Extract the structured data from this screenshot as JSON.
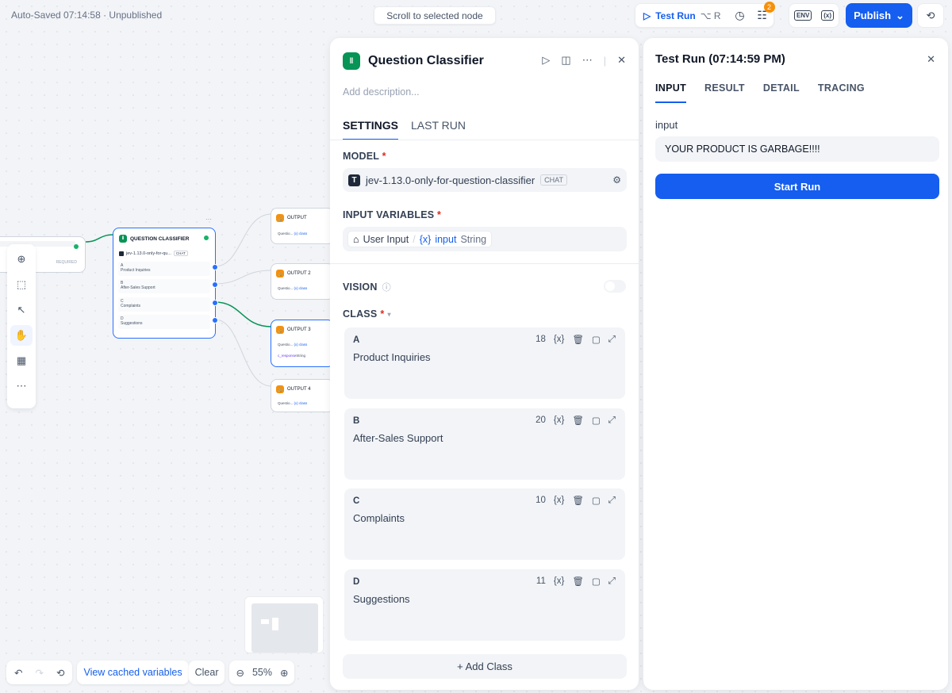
{
  "status": {
    "autosave": "Auto-Saved 07:14:58 · Unpublished"
  },
  "scroll_button": "Scroll to selected node",
  "topbar": {
    "test_run": "Test Run",
    "test_run_shortcut": "⌥ R",
    "checklist_badge": "2",
    "env_label": "ENV",
    "publish": "Publish"
  },
  "canvas_nodes": {
    "start_node_label": "REQUIRED",
    "classifier": {
      "title": "QUESTION CLASSIFIER",
      "model": "jev-1.13.0-only-for-qu...",
      "model_tag": "CHAT",
      "classes": [
        {
          "letter": "A",
          "name": "Product Inquiries"
        },
        {
          "letter": "B",
          "name": "After-Sales Support"
        },
        {
          "letter": "C",
          "name": "Complaints"
        },
        {
          "letter": "D",
          "name": "Suggestions"
        }
      ]
    },
    "outputs": [
      {
        "title": "OUTPUT",
        "var": "Questio...",
        "var2": "(x) class"
      },
      {
        "title": "OUTPUT 2",
        "var": "Questio...",
        "var2": "(x) class"
      },
      {
        "title": "OUTPUT 3",
        "var": "Questio...",
        "var2": "(x) class",
        "var3": "c_response",
        "var3_type": "String"
      },
      {
        "title": "OUTPUT 4",
        "var": "Questio...",
        "var2": "(x) class"
      }
    ]
  },
  "bottom": {
    "view_cached": "View cached variables",
    "clear": "Clear",
    "zoom": "55%"
  },
  "panel": {
    "title": "Question Classifier",
    "description_placeholder": "Add description...",
    "tabs": [
      "SETTINGS",
      "LAST RUN"
    ],
    "model_label": "MODEL",
    "model_name": "jev-1.13.0-only-for-question-classifier",
    "model_tag": "CHAT",
    "input_vars_label": "INPUT VARIABLES",
    "input_var_source": "User Input",
    "input_var_name": "input",
    "input_var_type": "String",
    "vision_label": "VISION",
    "class_label": "CLASS",
    "classes": [
      {
        "letter": "A",
        "name": "Product Inquiries",
        "count": "18"
      },
      {
        "letter": "B",
        "name": "After-Sales Support",
        "count": "20"
      },
      {
        "letter": "C",
        "name": "Complaints",
        "count": "10"
      },
      {
        "letter": "D",
        "name": "Suggestions",
        "count": "11"
      }
    ],
    "add_class": "+ Add Class"
  },
  "test_run": {
    "title": "Test Run (07:14:59 PM)",
    "tabs": [
      "INPUT",
      "RESULT",
      "DETAIL",
      "TRACING"
    ],
    "input_label": "input",
    "input_value": "YOUR PRODUCT IS GARBAGE!!!!",
    "start_button": "Start Run"
  }
}
